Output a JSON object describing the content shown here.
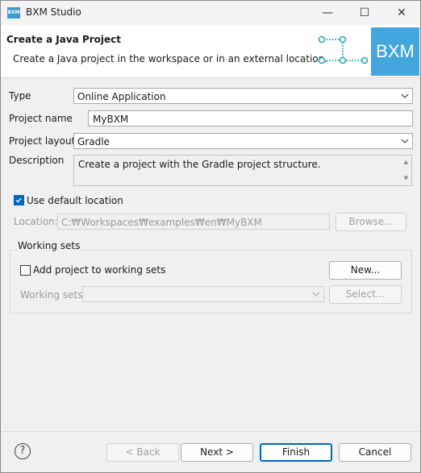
{
  "window": {
    "title": "BXM Studio",
    "app_icon_text": "BXM",
    "controls": {
      "minimize": "—",
      "maximize": "☐",
      "close": "✕"
    }
  },
  "header": {
    "title": "Create a Java Project",
    "description": "Create a Java project in the workspace or in an external location.",
    "logo_text": "BXM"
  },
  "form": {
    "type_label": "Type",
    "type_value": "Online Application",
    "project_name_label": "Project name",
    "project_name_value": "MyBXM",
    "project_layout_label": "Project layout",
    "project_layout_value": "Gradle",
    "description_label": "Description",
    "description_value": "Create a project with the Gradle project structure.",
    "use_default_location_label": "Use default location",
    "use_default_location_checked": true,
    "location_label": "Location:",
    "location_value": "C:₩Workspaces₩examples₩en₩MyBXM",
    "browse_label": "Browse..."
  },
  "working_sets": {
    "group_label": "Working sets",
    "add_label": "Add project to working sets",
    "add_checked": false,
    "new_label": "New...",
    "sets_label": "Working sets:",
    "sets_value": "",
    "select_label": "Select..."
  },
  "footer": {
    "help_icon": "?",
    "back_label": "< Back",
    "next_label": "Next >",
    "finish_label": "Finish",
    "cancel_label": "Cancel"
  },
  "colors": {
    "accent": "#0067c0",
    "logo_bg": "#43a6dc",
    "diagram": "#2aa8b8"
  }
}
